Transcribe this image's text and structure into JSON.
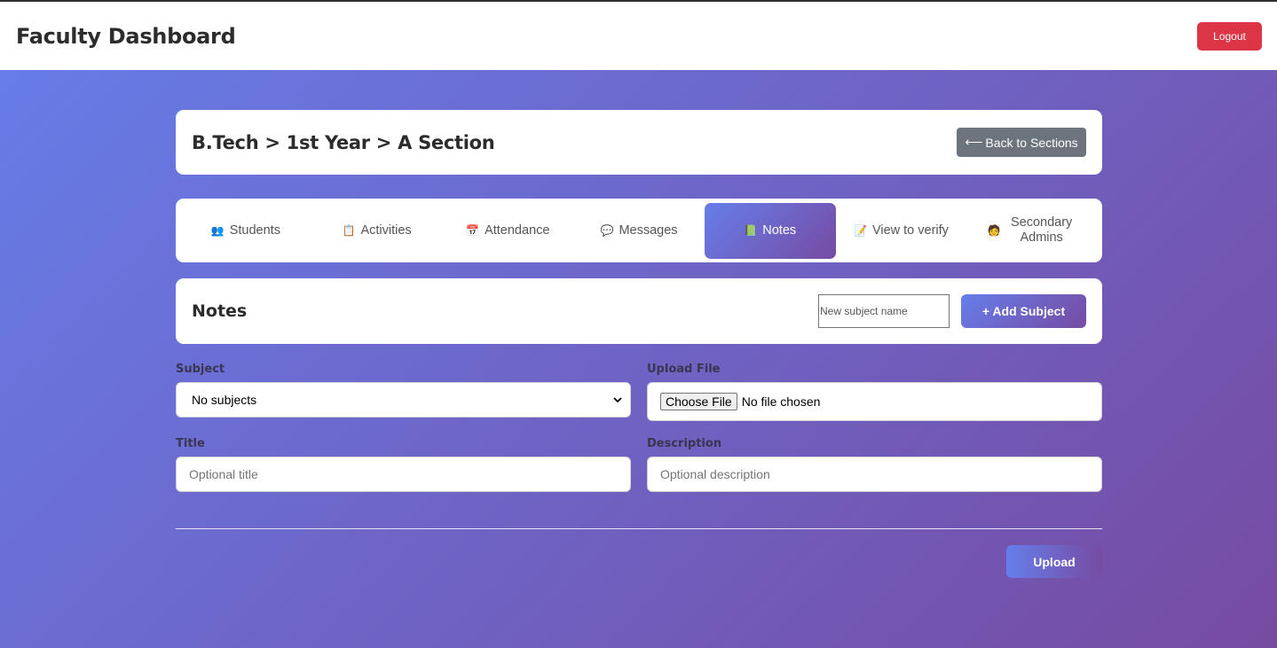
{
  "app": {
    "title": "Faculty Dashboard",
    "logout_label": "Logout"
  },
  "header": {
    "breadcrumb": "B.Tech > 1st Year > A Section",
    "back_label": "Back to Sections",
    "back_icon": "⟵"
  },
  "tabs": [
    {
      "label": "Students",
      "icon": "👥",
      "icon_name": "students-icon"
    },
    {
      "label": "Activities",
      "icon": "📋",
      "icon_name": "clipboard-icon"
    },
    {
      "label": "Attendance",
      "icon": "📅",
      "icon_name": "calendar-icon"
    },
    {
      "label": "Messages",
      "icon": "💬",
      "icon_name": "speech-bubble-icon"
    },
    {
      "label": "Notes",
      "icon": "📗",
      "icon_name": "notes-icon",
      "active": true
    },
    {
      "label": "View to verify",
      "icon": "📝",
      "icon_name": "memo-icon"
    },
    {
      "label": "Secondary Admins",
      "icon": "🧑",
      "icon_name": "admin-icon"
    }
  ],
  "notes": {
    "title": "Notes",
    "new_subject_placeholder": "New subject name",
    "add_subject_label": "+ Add Subject"
  },
  "form": {
    "subject_label": "Subject",
    "subject_value": "No subjects",
    "upload_label": "Upload File",
    "choose_file_label": "Choose File",
    "file_status": "No file chosen",
    "title_label": "Title",
    "title_placeholder": "Optional title",
    "description_label": "Description",
    "description_placeholder": "Optional description",
    "upload_button": "Upload"
  }
}
